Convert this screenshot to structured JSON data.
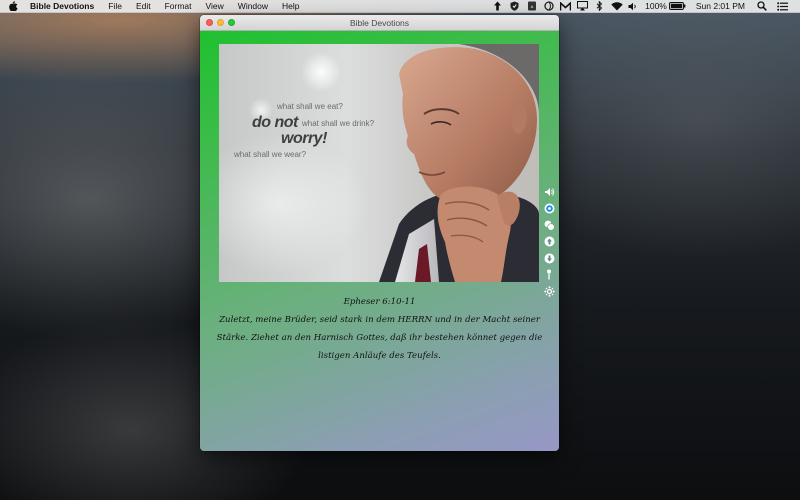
{
  "menubar": {
    "app_name": "Bible Devotions",
    "items": [
      "File",
      "Edit",
      "Format",
      "View",
      "Window",
      "Help"
    ],
    "battery_percent": "100%",
    "clock": "Sun 2:01 PM",
    "status_icons": [
      "upload-arrow-icon",
      "shield-icon",
      "pdf-icon",
      "swirl-icon",
      "airplay-icon",
      "bluetooth-icon",
      "wifi-icon",
      "volume-icon",
      "battery-icon",
      "spotlight-search-icon",
      "notification-center-icon"
    ]
  },
  "window": {
    "title": "Bible Devotions"
  },
  "image": {
    "line1": "what shall we eat?",
    "line2a": "do not",
    "line2b": "what shall we drink?",
    "line3": "worry!",
    "line4": "what shall we wear?"
  },
  "tools": [
    "share-icon",
    "target-icon",
    "copy-icon",
    "up-arrow-icon",
    "down-arrow-icon",
    "pin-icon",
    "settings-icon"
  ],
  "verse": {
    "reference": "Epheser 6:10-11",
    "text": "Zuletzt, meine Brüder, seid stark in dem HERRN und in der Macht seiner Stärke. Ziehet an den Harnisch Gottes, daß ihr bestehen könnet gegen die listigen Anläufe des Teufels."
  },
  "colors": {
    "gradient_top": "#1fc12f",
    "gradient_bottom": "#9797c6",
    "tool_blue": "#1e8fe8"
  }
}
